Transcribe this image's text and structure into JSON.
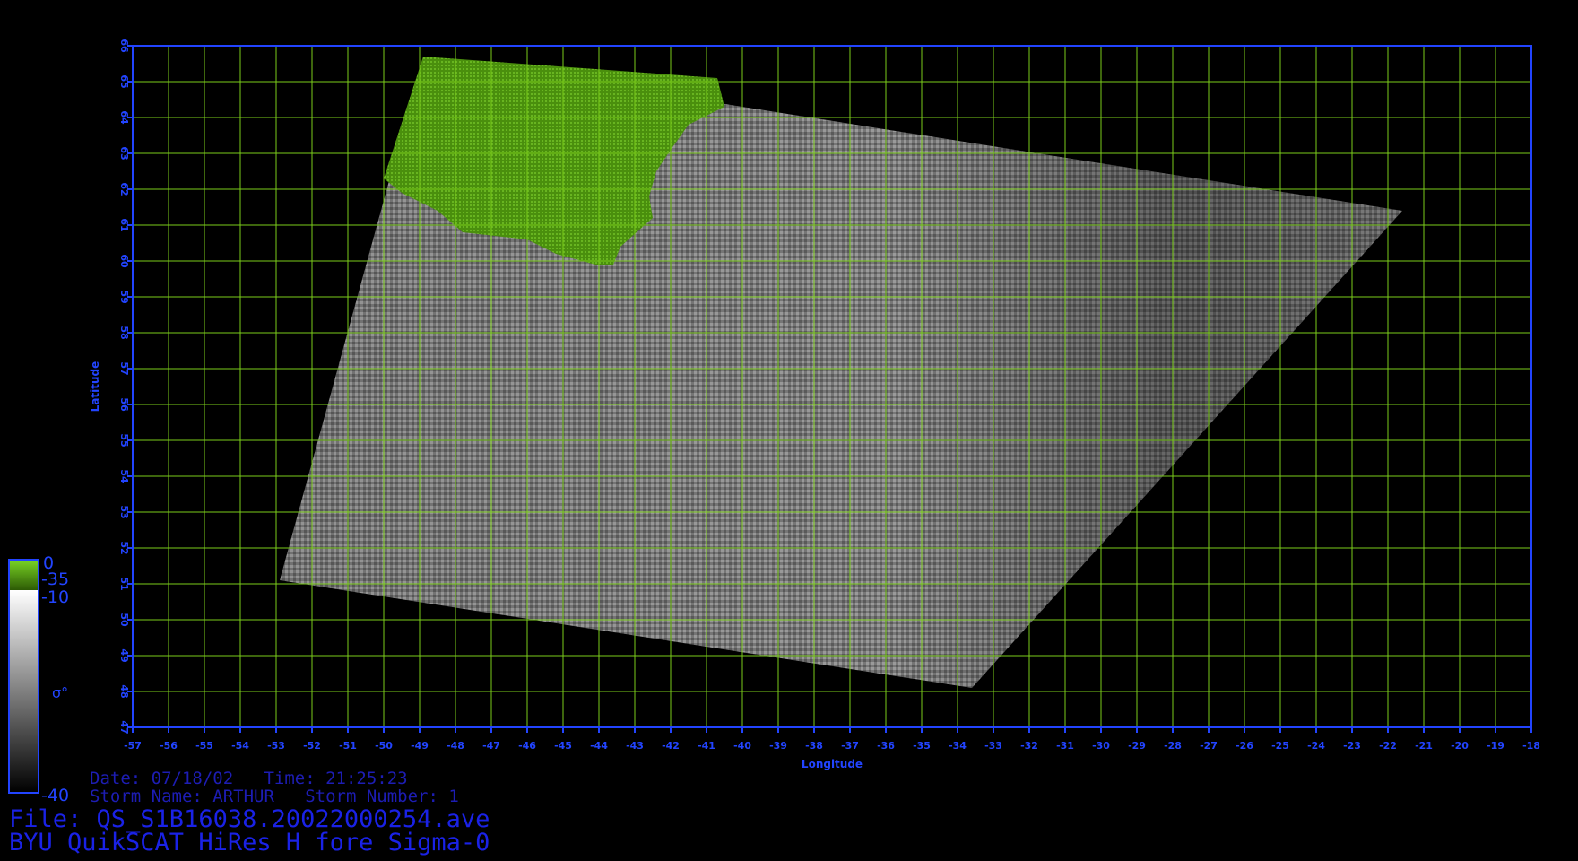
{
  "map": {
    "lon_min": -57,
    "lon_max": -18,
    "lat_min": 47,
    "lat_max": 66,
    "lon_ticks": [
      "-57",
      "-56",
      "-55",
      "-54",
      "-53",
      "-52",
      "-51",
      "-50",
      "-49",
      "-48",
      "-47",
      "-46",
      "-45",
      "-44",
      "-43",
      "-42",
      "-41",
      "-40",
      "-39",
      "-38",
      "-37",
      "-36",
      "-35",
      "-34",
      "-33",
      "-32",
      "-31",
      "-30",
      "-29",
      "-28",
      "-27",
      "-26",
      "-25",
      "-24",
      "-23",
      "-22",
      "-21",
      "-20",
      "-19",
      "-18"
    ],
    "lat_ticks": [
      "47",
      "48",
      "49",
      "50",
      "51",
      "52",
      "53",
      "54",
      "55",
      "56",
      "57",
      "58",
      "59",
      "60",
      "61",
      "62",
      "63",
      "64",
      "65",
      "66"
    ],
    "xlabel": "Longitude",
    "ylabel": "Latitude",
    "grid": true,
    "colors": {
      "background": "#000000",
      "grid": "#7acc1a",
      "axes": "#2244ff",
      "text": "#1a22e6",
      "land": "#4e9a0c",
      "ocean_dark": "#3a3a3a",
      "ocean_light": "#a8a8a8"
    },
    "swath_corners": [
      {
        "lon": -48.9,
        "lat": 65.7
      },
      {
        "lon": -21.6,
        "lat": 61.4
      },
      {
        "lon": -33.6,
        "lat": 48.1
      },
      {
        "lon": -52.9,
        "lat": 51.1
      }
    ],
    "land_region": "Greenland",
    "land_outline": [
      {
        "lon": -48.9,
        "lat": 65.7
      },
      {
        "lon": -40.7,
        "lat": 65.1
      },
      {
        "lon": -40.5,
        "lat": 64.3
      },
      {
        "lon": -41.5,
        "lat": 63.8
      },
      {
        "lon": -42.0,
        "lat": 63.1
      },
      {
        "lon": -42.4,
        "lat": 62.5
      },
      {
        "lon": -42.6,
        "lat": 61.8
      },
      {
        "lon": -42.5,
        "lat": 61.2
      },
      {
        "lon": -43.4,
        "lat": 60.4
      },
      {
        "lon": -43.6,
        "lat": 59.9
      },
      {
        "lon": -44.1,
        "lat": 59.9
      },
      {
        "lon": -45.2,
        "lat": 60.2
      },
      {
        "lon": -46.0,
        "lat": 60.6
      },
      {
        "lon": -47.8,
        "lat": 60.8
      },
      {
        "lon": -48.5,
        "lat": 61.4
      },
      {
        "lon": -49.5,
        "lat": 61.9
      },
      {
        "lon": -50.0,
        "lat": 62.3
      }
    ]
  },
  "colorbar": {
    "top_label": "0",
    "land_label": "-35",
    "ocean_top_label": "-10",
    "bottom_label": "-40",
    "symbol": "σ°"
  },
  "info": {
    "date_line": "Date: 07/18/02   Time: 21:25:23",
    "storm_line": "Storm Name: ARTHUR   Storm Number: 1",
    "file_line": "File: QS_S1B16038.20022000254.ave",
    "product_line": "BYU QuikSCAT HiRes H fore Sigma-0"
  }
}
